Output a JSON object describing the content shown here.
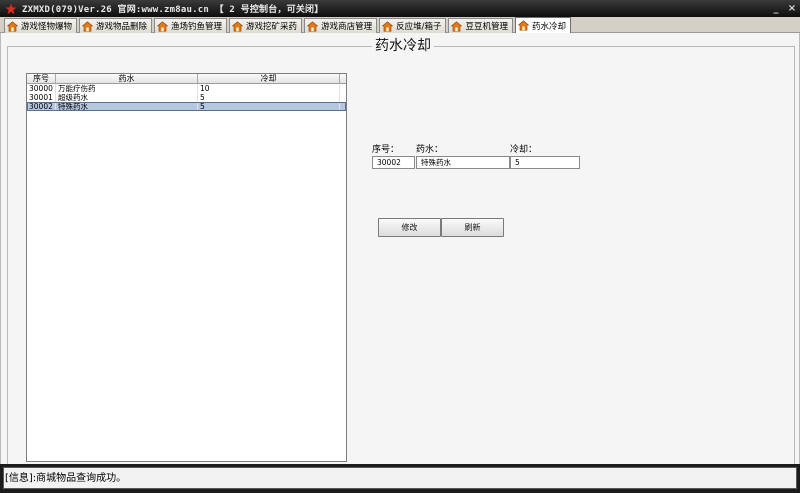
{
  "window": {
    "title": "ZXMXD(079)Ver.26 官网:www.zm8au.cn 【 2 号控制台，可关闭】",
    "minimize_glyph": "_",
    "close_glyph": "×"
  },
  "tabs": [
    {
      "label": "游戏怪物爆物",
      "icon": "house-icon"
    },
    {
      "label": "游戏物品删除",
      "icon": "house-icon"
    },
    {
      "label": "渔场钓鱼管理",
      "icon": "house-icon"
    },
    {
      "label": "游戏挖矿采药",
      "icon": "house-icon"
    },
    {
      "label": "游戏商店管理",
      "icon": "house-icon"
    },
    {
      "label": "反应堆/箱子",
      "icon": "house-icon"
    },
    {
      "label": "豆豆机管理",
      "icon": "house-icon"
    },
    {
      "label": "药水冷却",
      "icon": "house-icon",
      "active": true
    }
  ],
  "panel": {
    "title": "药水冷却"
  },
  "table": {
    "headers": [
      "序号",
      "药水",
      "冷却"
    ],
    "rows": [
      [
        "30000",
        "万能疗伤药",
        "10"
      ],
      [
        "30001",
        "超级药水",
        "5"
      ],
      [
        "30002",
        "特殊药水",
        "5"
      ]
    ],
    "selected_index": 2
  },
  "form": {
    "id_label": "序号：",
    "name_label": "药水：",
    "cooldown_label": "冷却：",
    "id_value": "30002",
    "name_value": "特殊药水",
    "cooldown_value": "5"
  },
  "buttons": {
    "modify": "修改",
    "refresh": "刷新"
  },
  "status": {
    "message": "[信息]:商城物品查询成功。"
  },
  "colors": {
    "icon_orange": "#e07a1a",
    "selection": "#b6c8e0",
    "titlebar": "#0d0d0d"
  }
}
